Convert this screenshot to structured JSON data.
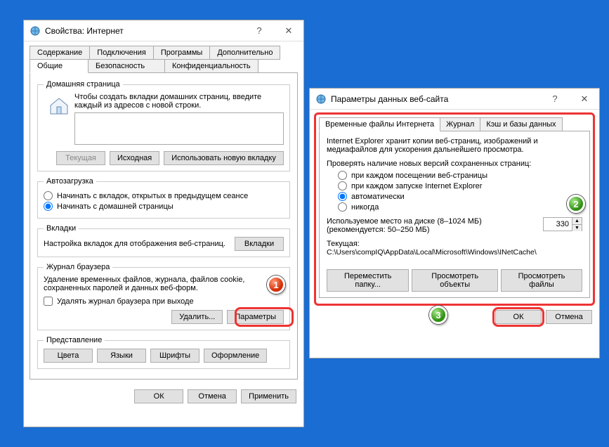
{
  "win1": {
    "title": "Свойства: Интернет",
    "tabs_row1": [
      "Содержание",
      "Подключения",
      "Программы",
      "Дополнительно"
    ],
    "tabs_row2": [
      "Общие",
      "Безопасность",
      "Конфиденциальность"
    ],
    "homepage": {
      "legend": "Домашняя страница",
      "hint": "Чтобы создать вкладки домашних страниц, введите каждый из адресов с новой строки.",
      "btn_current": "Текущая",
      "btn_default": "Исходная",
      "btn_newtab": "Использовать новую вкладку"
    },
    "autostart": {
      "legend": "Автозагрузка",
      "opt_tabs": "Начинать с вкладок, открытых в предыдущем сеансе",
      "opt_home": "Начинать с домашней страницы"
    },
    "tabs_sec": {
      "legend": "Вкладки",
      "text": "Настройка вкладок для отображения веб-страниц.",
      "btn": "Вкладки"
    },
    "history": {
      "legend": "Журнал браузера",
      "text": "Удаление временных файлов, журнала, файлов cookie, сохраненных паролей и данных веб-форм.",
      "chk": "Удалять журнал браузера при выходе",
      "btn_delete": "Удалить...",
      "btn_params": "Параметры"
    },
    "presentation": {
      "legend": "Представление",
      "btn_colors": "Цвета",
      "btn_lang": "Языки",
      "btn_fonts": "Шрифты",
      "btn_style": "Оформление"
    },
    "dlg": {
      "ok": "ОК",
      "cancel": "Отмена",
      "apply": "Применить"
    }
  },
  "win2": {
    "title": "Параметры данных веб-сайта",
    "tabs": [
      "Временные файлы Интернета",
      "Журнал",
      "Кэш и базы данных"
    ],
    "intro": "Internet Explorer хранит копии веб-страниц, изображений и медиафайлов для ускорения дальнейшего просмотра.",
    "check_label": "Проверять наличие новых версий сохраненных страниц:",
    "opts": {
      "every_visit": "при каждом посещении веб-страницы",
      "every_start": "при каждом запуске Internet Explorer",
      "auto": "автоматически",
      "never": "никогда"
    },
    "disk": {
      "label": "Используемое место на диске (8–1024 МБ)",
      "rec": "(рекомендуется: 50–250 МБ)",
      "value": "330"
    },
    "current_label": "Текущая:",
    "current_path": "C:\\Users\\compIQ\\AppData\\Local\\Microsoft\\Windows\\INetCache\\",
    "btns": {
      "move": "Переместить папку...",
      "view_obj": "Просмотреть объекты",
      "view_files": "Просмотреть файлы"
    },
    "dlg": {
      "ok": "ОК",
      "cancel": "Отмена"
    },
    "help": "?"
  },
  "callouts": {
    "b1": "1",
    "b2": "2",
    "b3": "3"
  }
}
